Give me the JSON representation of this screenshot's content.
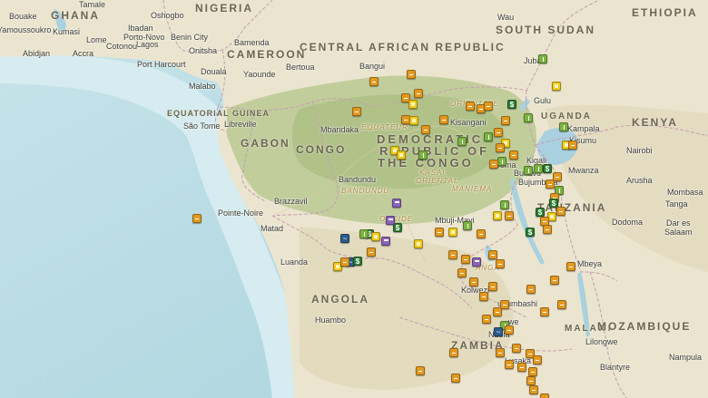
{
  "map": {
    "countries": [
      {
        "id": "nigeria",
        "name": "NIGERIA"
      },
      {
        "id": "ghana",
        "name": "GHANA"
      },
      {
        "id": "car",
        "name": "CENTRAL AFRICAN REPUBLIC"
      },
      {
        "id": "south-sudan",
        "name": "SOUTH SUDAN"
      },
      {
        "id": "ethiopia",
        "name": "ETHIOPIA"
      },
      {
        "id": "cameroon",
        "name": "CAMEROON"
      },
      {
        "id": "gabon",
        "name": "GABON"
      },
      {
        "id": "congo",
        "name": "CONGO"
      },
      {
        "id": "eq-guinea",
        "name": "EQUATORIAL GUINEA"
      },
      {
        "id": "uganda",
        "name": "UGANDA"
      },
      {
        "id": "kenya",
        "name": "KENYA"
      },
      {
        "id": "drc-1",
        "name": "DEMOCRATIC"
      },
      {
        "id": "drc-2",
        "name": "REPUBLIC OF"
      },
      {
        "id": "drc-3",
        "name": "THE CONGO"
      },
      {
        "id": "tanzania",
        "name": "TANZANIA"
      },
      {
        "id": "angola",
        "name": "ANGOLA"
      },
      {
        "id": "zambia",
        "name": "ZAMBIA"
      },
      {
        "id": "malawi",
        "name": "MALAWI"
      },
      {
        "id": "mozambique",
        "name": "MOZAMBIQUE"
      }
    ],
    "regions": [
      {
        "id": "equateur",
        "name": "EQUATEUR"
      },
      {
        "id": "orientale",
        "name": "ORIENTALE"
      },
      {
        "id": "kasai-oriental-1",
        "name": "KASAI-"
      },
      {
        "id": "kasai-oriental-2",
        "name": "ORIENTAL"
      },
      {
        "id": "maniema",
        "name": "MANIEMA"
      },
      {
        "id": "bandundu",
        "name": "BANDUNDU"
      },
      {
        "id": "occidental",
        "name": "OCCIDE"
      },
      {
        "id": "katanga",
        "name": "ANGA"
      }
    ],
    "cities": [
      {
        "id": "bouake",
        "name": "Bouake"
      },
      {
        "id": "tamale",
        "name": "Tamale"
      },
      {
        "id": "ibadan",
        "name": "Ibadan"
      },
      {
        "id": "osogbo",
        "name": "Oshogbo"
      },
      {
        "id": "kumasi",
        "name": "Kumasi"
      },
      {
        "id": "yamoussoukro",
        "name": "Yamoussoukro"
      },
      {
        "id": "lome",
        "name": "Lome"
      },
      {
        "id": "porto-novo",
        "name": "Porto-Novo"
      },
      {
        "id": "benin-city",
        "name": "Benin City"
      },
      {
        "id": "lagos",
        "name": "Lagos"
      },
      {
        "id": "cotonou",
        "name": "Cotonou"
      },
      {
        "id": "accra",
        "name": "Accra"
      },
      {
        "id": "abidjan",
        "name": "Abidjan"
      },
      {
        "id": "onitsha",
        "name": "Onitsha"
      },
      {
        "id": "port-harcourt",
        "name": "Port Harcourt"
      },
      {
        "id": "bamenda",
        "name": "Bamenda"
      },
      {
        "id": "douala",
        "name": "Douala"
      },
      {
        "id": "yaounde",
        "name": "Yaounde"
      },
      {
        "id": "bertoua",
        "name": "Bertoua"
      },
      {
        "id": "malabo",
        "name": "Malabo"
      },
      {
        "id": "sao-tome",
        "name": "São Tome"
      },
      {
        "id": "libreville",
        "name": "Libreville"
      },
      {
        "id": "bangui",
        "name": "Bangui"
      },
      {
        "id": "mbandaka",
        "name": "Mbandaka"
      },
      {
        "id": "kisangani",
        "name": "Kisangani"
      },
      {
        "id": "juba",
        "name": "Juba"
      },
      {
        "id": "wau",
        "name": "Wau"
      },
      {
        "id": "gulu",
        "name": "Gulu"
      },
      {
        "id": "kampala",
        "name": "Kampala"
      },
      {
        "id": "kisumu",
        "name": "Kisumu"
      },
      {
        "id": "nairobi",
        "name": "Nairobi"
      },
      {
        "id": "kigali",
        "name": "Kigali"
      },
      {
        "id": "goma",
        "name": "Goma"
      },
      {
        "id": "bukavu",
        "name": "Bukavu"
      },
      {
        "id": "bujumbura",
        "name": "Bujumbura"
      },
      {
        "id": "mwanza",
        "name": "Mwanza"
      },
      {
        "id": "arusha",
        "name": "Arusha"
      },
      {
        "id": "mombasa",
        "name": "Mombasa"
      },
      {
        "id": "tanga",
        "name": "Tanga"
      },
      {
        "id": "dodoma",
        "name": "Dodoma"
      },
      {
        "id": "dar-es-salaam-1",
        "name": "Dar es"
      },
      {
        "id": "dar-es-salaam-2",
        "name": "Salaam"
      },
      {
        "id": "bandundu",
        "name": "Bandundu"
      },
      {
        "id": "brazzaville",
        "name": "Brazzavil"
      },
      {
        "id": "pointe-noire",
        "name": "Pointe-Noire"
      },
      {
        "id": "matadi",
        "name": "Matad"
      },
      {
        "id": "mbuji-mayi",
        "name": "Mbuji-Mayi"
      },
      {
        "id": "luanda",
        "name": "Luanda"
      },
      {
        "id": "huambo",
        "name": "Huambo"
      },
      {
        "id": "mbeya",
        "name": "Mbeya"
      },
      {
        "id": "kolwezi",
        "name": "Kolwezi"
      },
      {
        "id": "lubumbashi",
        "name": "ubumbashi"
      },
      {
        "id": "chingola",
        "name": "we"
      },
      {
        "id": "ndola",
        "name": "Ndola"
      },
      {
        "id": "lusaka",
        "name": "Lusaka"
      },
      {
        "id": "lilongwe",
        "name": "Lilongwe"
      },
      {
        "id": "nampula",
        "name": "Nampula"
      },
      {
        "id": "blantyre",
        "name": "Blantyre"
      }
    ],
    "markers": [
      {
        "type": "road",
        "x": 20.0,
        "y": -5.5
      },
      {
        "type": "road",
        "x": 20.5,
        "y": -4.2
      },
      {
        "type": "road",
        "x": 17.5,
        "y": -5.0
      },
      {
        "type": "road",
        "x": 16.3,
        "y": -3.0
      },
      {
        "type": "road",
        "x": 19.6,
        "y": -3.9
      },
      {
        "type": "school",
        "x": 20.1,
        "y": -3.5
      },
      {
        "type": "road",
        "x": 19.6,
        "y": -2.5
      },
      {
        "type": "school",
        "x": 20.2,
        "y": -2.4
      },
      {
        "type": "road",
        "x": 21.0,
        "y": -1.8
      },
      {
        "type": "school",
        "x": 18.9,
        "y": -0.4
      },
      {
        "type": "school",
        "x": 19.3,
        "y": -0.1
      },
      {
        "type": "farm",
        "x": 20.8,
        "y": -0.1
      },
      {
        "type": "road",
        "x": 22.2,
        "y": -2.5
      },
      {
        "type": "road",
        "x": 24.0,
        "y": -3.4
      },
      {
        "type": "road",
        "x": 24.7,
        "y": -3.2
      },
      {
        "type": "road",
        "x": 25.2,
        "y": -3.4
      },
      {
        "type": "finance",
        "x": 26.8,
        "y": -3.5
      },
      {
        "type": "road",
        "x": 26.4,
        "y": -2.4
      },
      {
        "type": "farm",
        "x": 27.9,
        "y": -2.6
      },
      {
        "type": "school",
        "x": 29.8,
        "y": -4.7
      },
      {
        "type": "farm",
        "x": 28.9,
        "y": -6.5
      },
      {
        "type": "farm",
        "x": 30.3,
        "y": -2.0
      },
      {
        "type": "school",
        "x": 30.5,
        "y": -0.8
      },
      {
        "type": "road",
        "x": 30.9,
        "y": -0.8
      },
      {
        "type": "farm",
        "x": 23.4,
        "y": -1.0
      },
      {
        "type": "farm",
        "x": 25.2,
        "y": -1.3
      },
      {
        "type": "road",
        "x": 25.9,
        "y": -1.6
      },
      {
        "type": "school",
        "x": 26.4,
        "y": -0.9
      },
      {
        "type": "road",
        "x": 26.0,
        "y": -0.6
      },
      {
        "type": "road",
        "x": 26.9,
        "y": -0.1
      },
      {
        "type": "farm",
        "x": 26.1,
        "y": 0.3
      },
      {
        "type": "road",
        "x": 25.6,
        "y": 0.5
      },
      {
        "type": "farm",
        "x": 27.9,
        "y": 0.9
      },
      {
        "type": "farm",
        "x": 28.6,
        "y": 0.8
      },
      {
        "type": "finance",
        "x": 29.2,
        "y": 0.8
      },
      {
        "type": "road",
        "x": 29.9,
        "y": 1.3
      },
      {
        "type": "road",
        "x": 29.4,
        "y": 1.8
      },
      {
        "type": "farm",
        "x": 30.0,
        "y": 2.2
      },
      {
        "type": "road",
        "x": 29.7,
        "y": 2.7
      },
      {
        "type": "finance",
        "x": 29.6,
        "y": 3.1
      },
      {
        "type": "finance",
        "x": 28.7,
        "y": 3.7
      },
      {
        "type": "school",
        "x": 29.5,
        "y": 4.0
      },
      {
        "type": "road",
        "x": 29.0,
        "y": 4.3
      },
      {
        "type": "road",
        "x": 29.2,
        "y": 4.8
      },
      {
        "type": "road",
        "x": 30.1,
        "y": 3.6
      },
      {
        "type": "farm",
        "x": 26.3,
        "y": 3.2
      },
      {
        "type": "school",
        "x": 25.8,
        "y": 3.9
      },
      {
        "type": "road",
        "x": 26.6,
        "y": 3.9
      },
      {
        "type": "farm",
        "x": 23.8,
        "y": 4.6
      },
      {
        "type": "finance",
        "x": 28.0,
        "y": 5.0
      },
      {
        "type": "road",
        "x": 24.7,
        "y": 5.1
      },
      {
        "type": "school",
        "x": 22.8,
        "y": 5.0
      },
      {
        "type": "road",
        "x": 21.9,
        "y": 5.0
      },
      {
        "type": "finance",
        "x": 19.1,
        "y": 4.7
      },
      {
        "type": "gov",
        "x": 18.6,
        "y": 4.2
      },
      {
        "type": "gov",
        "x": 19.0,
        "y": 3.1
      },
      {
        "type": "finance",
        "x": 17.2,
        "y": 5.1
      },
      {
        "type": "farm",
        "x": 16.8,
        "y": 5.1
      },
      {
        "type": "school",
        "x": 17.6,
        "y": 5.3
      },
      {
        "type": "gov",
        "x": 18.3,
        "y": 5.6
      },
      {
        "type": "school",
        "x": 20.5,
        "y": 5.8
      },
      {
        "type": "road",
        "x": 17.3,
        "y": 6.3
      },
      {
        "type": "road",
        "x": 22.8,
        "y": 6.5
      },
      {
        "type": "road",
        "x": 23.7,
        "y": 6.8
      },
      {
        "type": "gov",
        "x": 24.4,
        "y": 7.0
      },
      {
        "type": "road",
        "x": 23.4,
        "y": 7.7
      },
      {
        "type": "road",
        "x": 25.5,
        "y": 6.5
      },
      {
        "type": "road",
        "x": 26.0,
        "y": 7.1
      },
      {
        "type": "road",
        "x": 24.2,
        "y": 8.3
      },
      {
        "type": "road",
        "x": 25.5,
        "y": 8.6
      },
      {
        "type": "road",
        "x": 24.9,
        "y": 9.3
      },
      {
        "type": "road",
        "x": 26.3,
        "y": 9.8
      },
      {
        "type": "road",
        "x": 28.1,
        "y": 8.8
      },
      {
        "type": "road",
        "x": 25.8,
        "y": 10.3
      },
      {
        "type": "road",
        "x": 25.1,
        "y": 10.8
      },
      {
        "type": "farm",
        "x": 26.3,
        "y": 11.2
      },
      {
        "type": "water",
        "x": 25.9,
        "y": 11.6
      },
      {
        "type": "road",
        "x": 26.6,
        "y": 11.5
      },
      {
        "type": "road",
        "x": 29.7,
        "y": 8.2
      },
      {
        "type": "road",
        "x": 30.2,
        "y": 9.8
      },
      {
        "type": "road",
        "x": 30.8,
        "y": 7.3
      },
      {
        "type": "road",
        "x": 29.0,
        "y": 10.3
      },
      {
        "type": "road",
        "x": 26.0,
        "y": 13.0
      },
      {
        "type": "road",
        "x": 26.6,
        "y": 13.8
      },
      {
        "type": "road",
        "x": 27.1,
        "y": 12.7
      },
      {
        "type": "road",
        "x": 27.5,
        "y": 14.0
      },
      {
        "type": "road",
        "x": 28.0,
        "y": 13.1
      },
      {
        "type": "road",
        "x": 28.2,
        "y": 14.3
      },
      {
        "type": "road",
        "x": 28.5,
        "y": 13.5
      },
      {
        "type": "road",
        "x": 28.1,
        "y": 14.9
      },
      {
        "type": "road",
        "x": 28.3,
        "y": 15.5
      },
      {
        "type": "road",
        "x": 29.0,
        "y": 16.0
      },
      {
        "type": "road",
        "x": 28.7,
        "y": 16.3
      },
      {
        "type": "road",
        "x": 23.0,
        "y": 14.7
      },
      {
        "type": "road",
        "x": 22.9,
        "y": 13.0
      },
      {
        "type": "road",
        "x": 20.6,
        "y": 14.2
      },
      {
        "type": "road",
        "x": 5.5,
        "y": 4.1
      },
      {
        "type": "water",
        "x": 15.5,
        "y": 5.4
      },
      {
        "type": "water",
        "x": 15.9,
        "y": 7.0
      },
      {
        "type": "finance",
        "x": 16.4,
        "y": 6.9
      },
      {
        "type": "school",
        "x": 15.0,
        "y": 7.3
      },
      {
        "type": "road",
        "x": 15.5,
        "y": 7.0
      }
    ]
  }
}
